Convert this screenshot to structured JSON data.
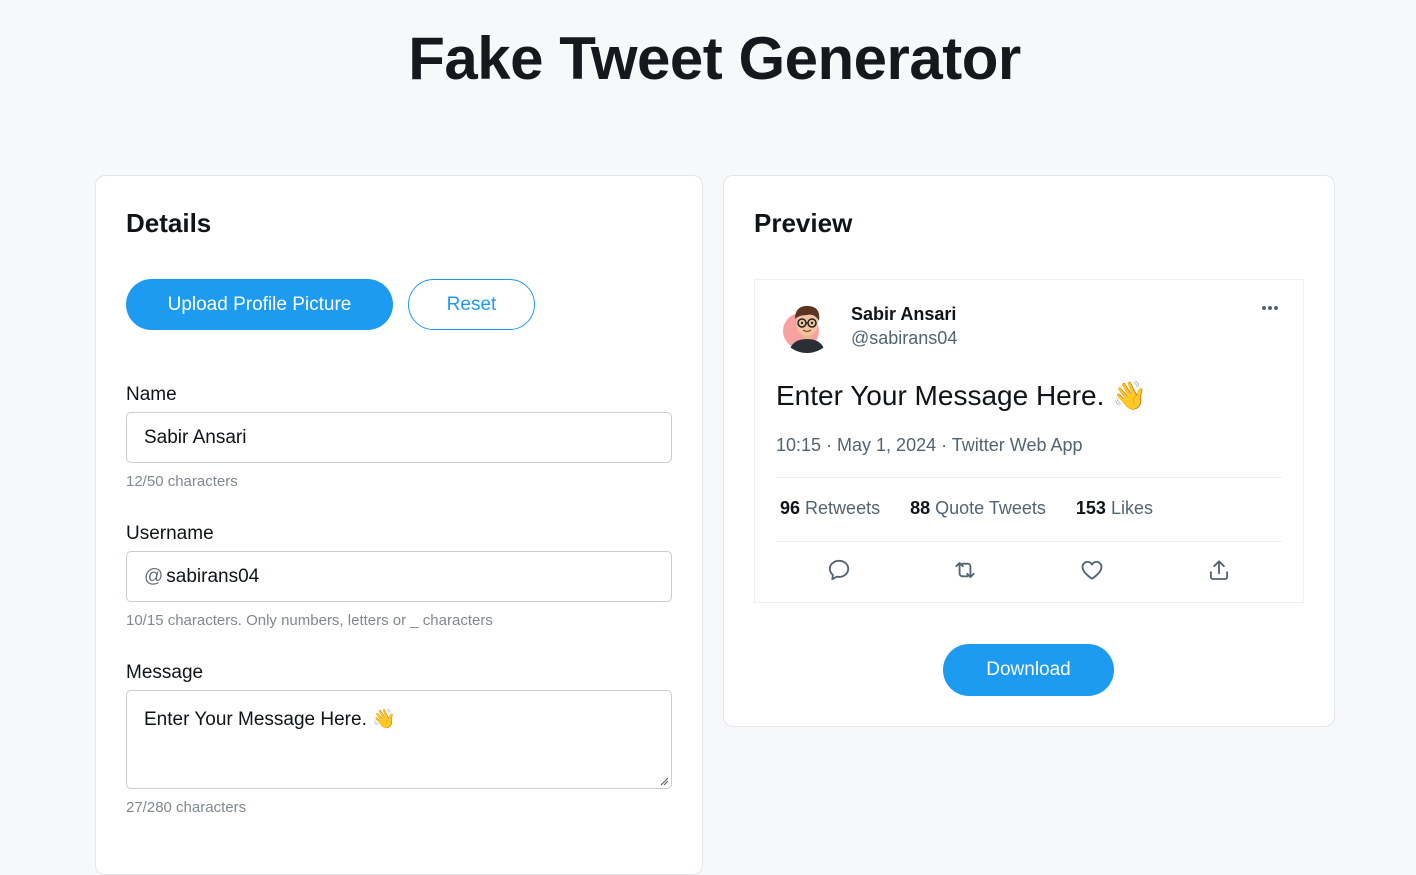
{
  "page": {
    "title": "Fake Tweet Generator"
  },
  "details": {
    "title": "Details",
    "upload_label": "Upload Profile Picture",
    "reset_label": "Reset",
    "name": {
      "label": "Name",
      "value": "Sabir Ansari",
      "hint": "12/50 characters"
    },
    "username": {
      "label": "Username",
      "prefix": "@",
      "value": "sabirans04",
      "hint": "10/15 characters. Only numbers, letters or _ characters"
    },
    "message": {
      "label": "Message",
      "value": "Enter Your Message Here. 👋",
      "hint": "27/280 characters"
    }
  },
  "preview": {
    "title": "Preview",
    "tweet": {
      "name": "Sabir Ansari",
      "handle": "@sabirans04",
      "message": "Enter Your Message Here. 👋",
      "meta": "10:15 · May 1, 2024 · Twitter Web App",
      "retweets": {
        "count": "96",
        "label": "Retweets"
      },
      "quote_tweets": {
        "count": "88",
        "label": "Quote Tweets"
      },
      "likes": {
        "count": "153",
        "label": "Likes"
      },
      "actions": [
        "comment-icon",
        "retweet-icon",
        "like-icon",
        "share-icon"
      ]
    },
    "download_label": "Download"
  },
  "colors": {
    "accent": "#1d9bf0",
    "background": "#f7f8fa",
    "muted": "#536471"
  }
}
